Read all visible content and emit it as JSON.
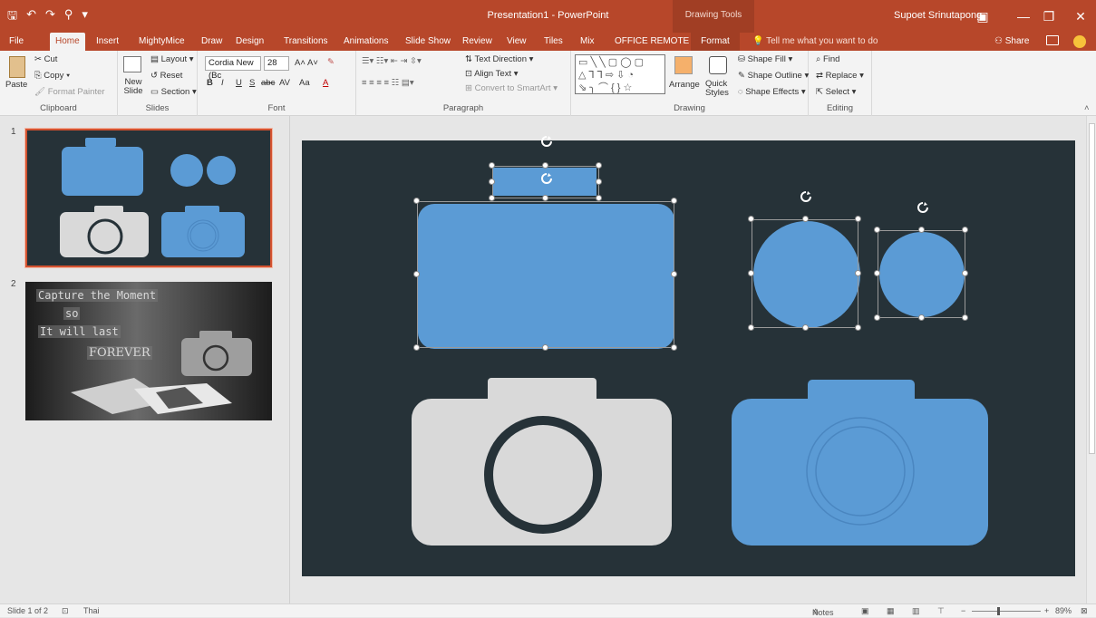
{
  "window": {
    "title": "Presentation1 - PowerPoint",
    "tools_label": "Drawing Tools",
    "user": "Supoet Srinutapong",
    "minimize": "—",
    "restore": "❐",
    "close": "✕"
  },
  "tabs": {
    "file": "File",
    "home": "Home",
    "insert": "Insert",
    "mightymice": "MightyMice",
    "draw": "Draw",
    "design": "Design",
    "transitions": "Transitions",
    "animations": "Animations",
    "slideshow": "Slide Show",
    "review": "Review",
    "view": "View",
    "tiles": "Tiles",
    "mix": "Mix",
    "office_remote": "OFFICE REMOTE",
    "format": "Format",
    "tell_me": "Tell me what you want to do",
    "share": "Share"
  },
  "ribbon": {
    "clipboard": {
      "paste": "Paste",
      "cut": "Cut",
      "copy": "Copy",
      "format_painter": "Format Painter",
      "label": "Clipboard"
    },
    "slides": {
      "new_slide": "New Slide",
      "layout": "Layout",
      "reset": "Reset",
      "section": "Section",
      "label": "Slides"
    },
    "font": {
      "family": "Cordia New (Bc",
      "size": "28",
      "label": "Font",
      "bold": "B",
      "italic": "I",
      "underline": "U",
      "strike": "S",
      "shadow": "abc",
      "spacing": "AV",
      "case": "Aa",
      "color_a": "A"
    },
    "paragraph": {
      "text_direction": "Text Direction",
      "align_text": "Align Text",
      "convert_smartart": "Convert to SmartArt",
      "label": "Paragraph"
    },
    "drawing": {
      "arrange": "Arrange",
      "quick_styles": "Quick Styles",
      "shape_fill": "Shape Fill",
      "shape_outline": "Shape Outline",
      "shape_effects": "Shape Effects",
      "label": "Drawing"
    },
    "editing": {
      "find": "Find",
      "replace": "Replace",
      "select": "Select",
      "label": "Editing"
    }
  },
  "slides_pane": {
    "slide1_number": "1",
    "slide2_number": "2",
    "slide2_lines": [
      "Capture the Moment",
      "so",
      "It will last",
      "FOREVER"
    ]
  },
  "status": {
    "slide_counter": "Slide 1 of 2",
    "language": "Thai",
    "notes": "Notes",
    "zoom": "89%"
  },
  "colors": {
    "accent": "#b7472a",
    "slide_bg": "#263238",
    "blue_shape": "#5b9bd5",
    "gray_shape": "#d9d9d9"
  }
}
